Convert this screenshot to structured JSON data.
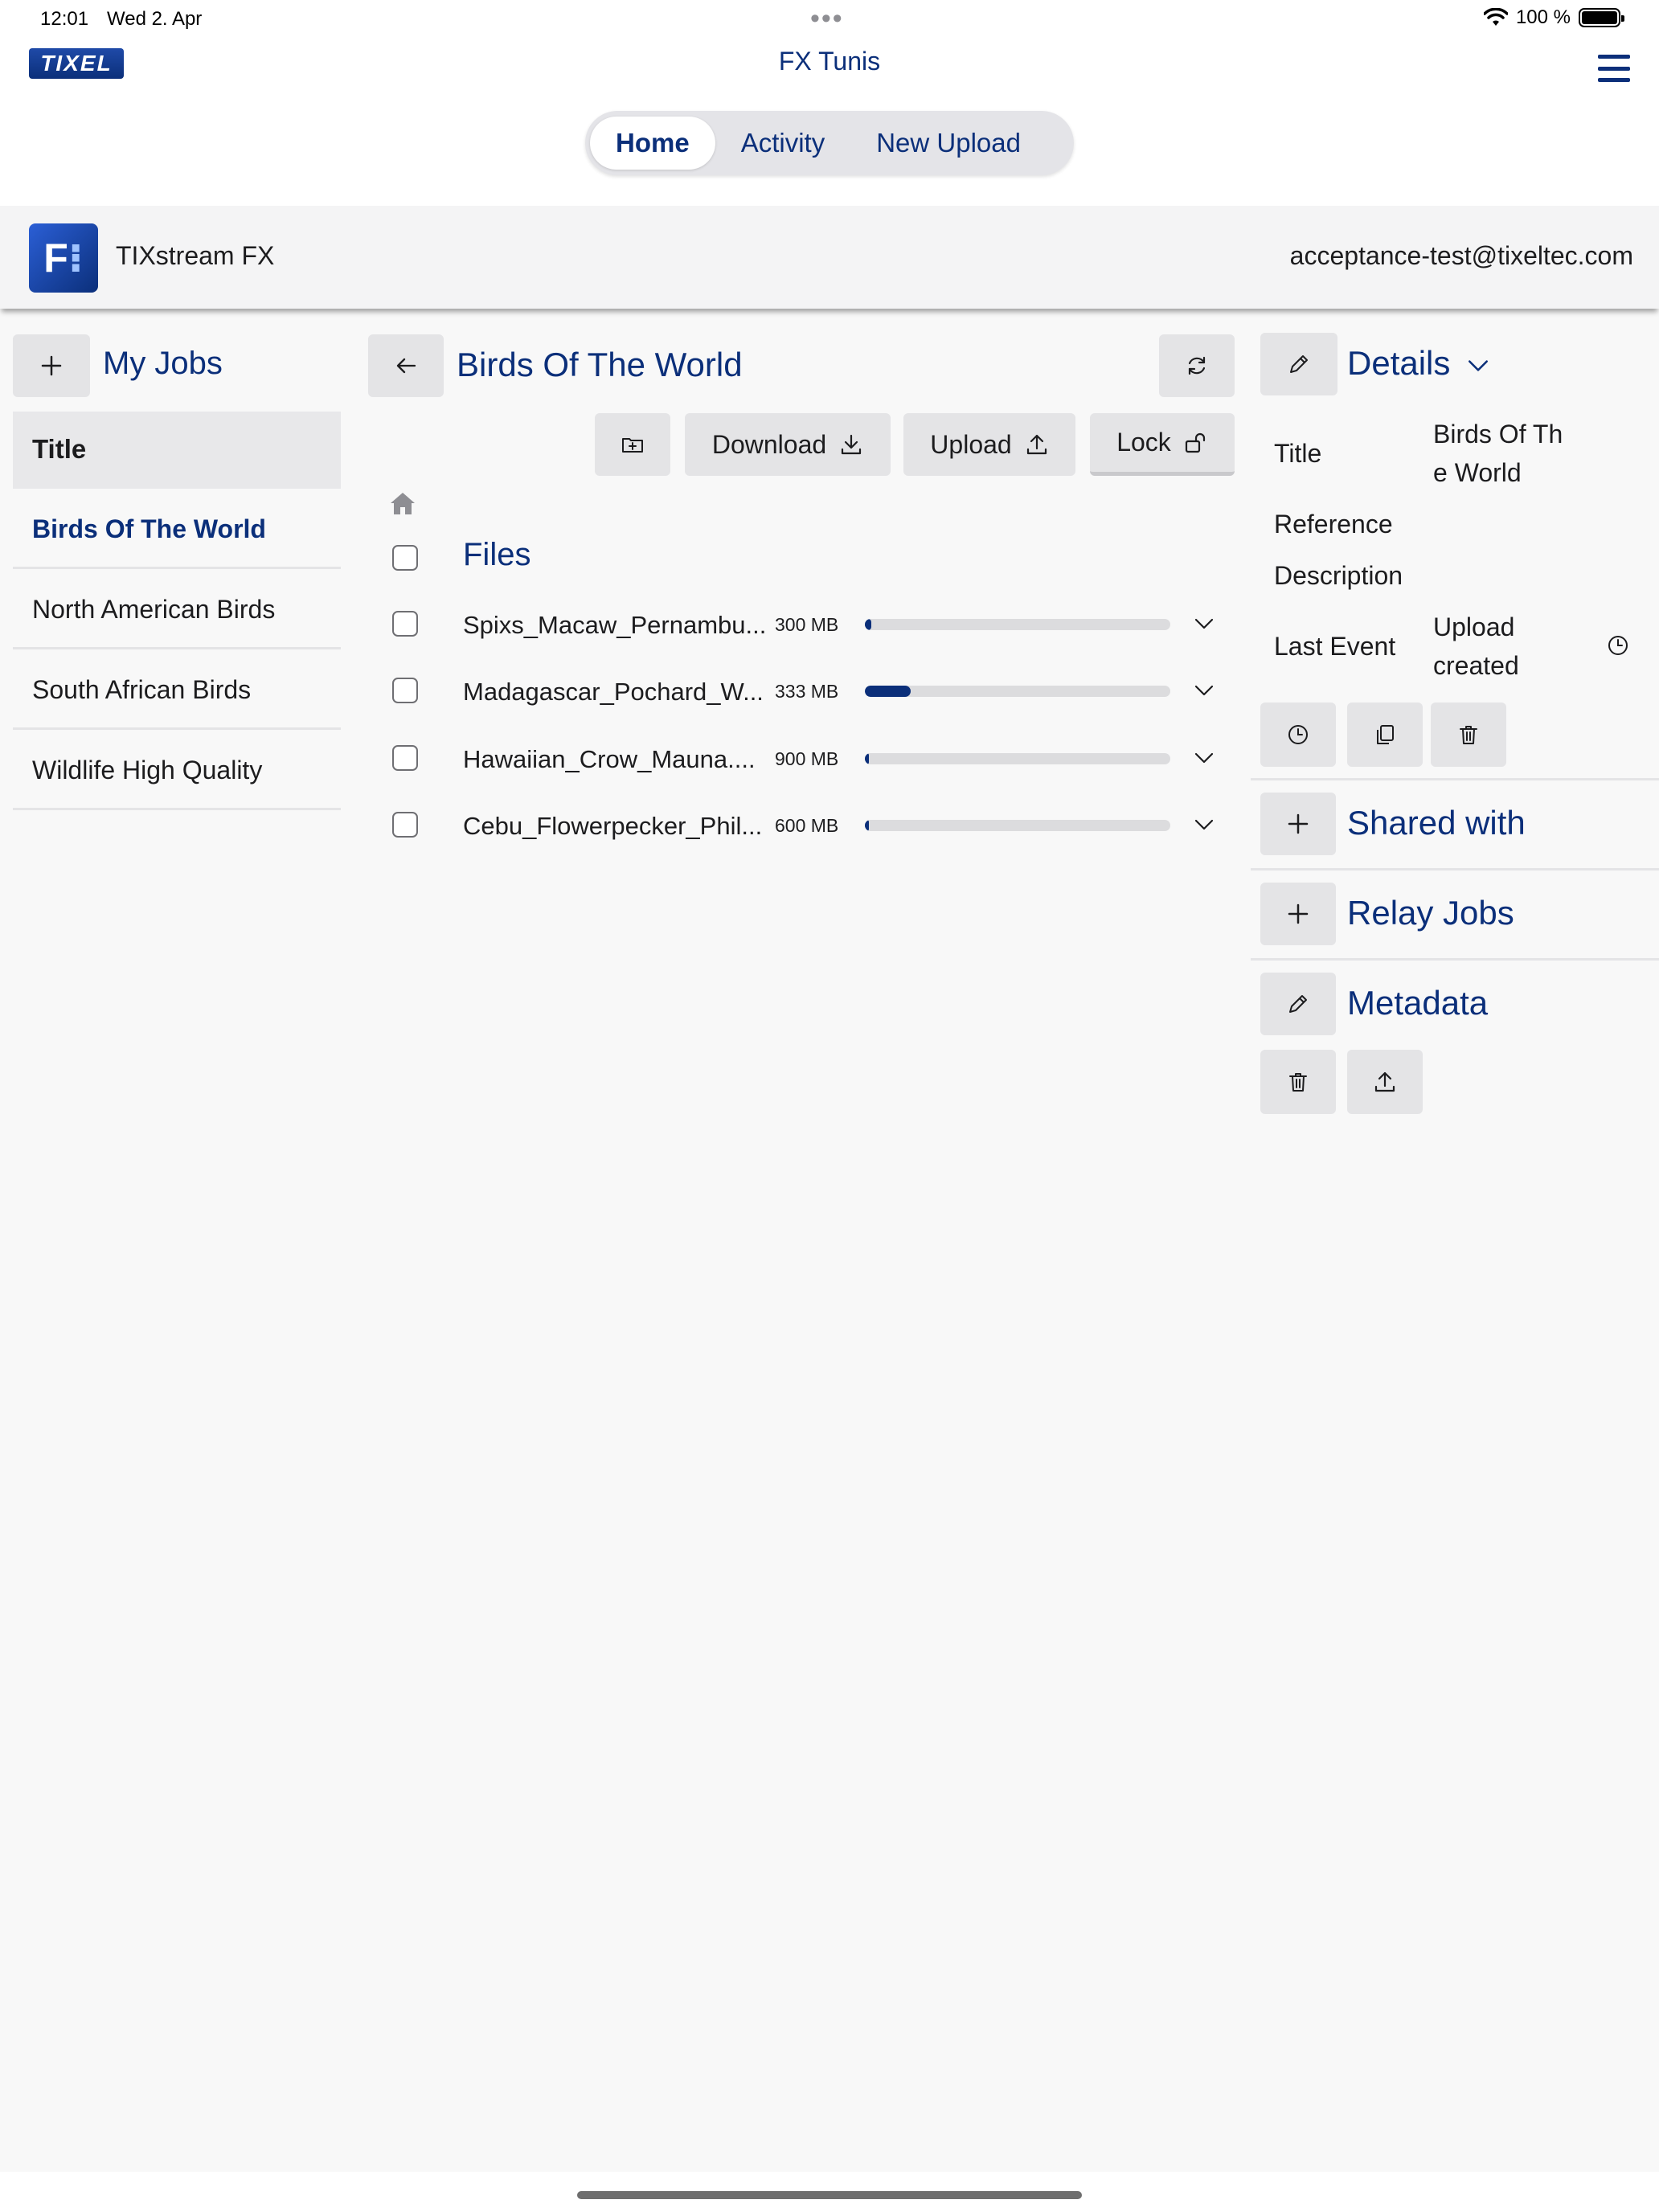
{
  "status_bar": {
    "time": "12:01",
    "date": "Wed 2. Apr",
    "battery": "100 %"
  },
  "header": {
    "logo_text": "TIXEL",
    "app_title": "FX Tunis",
    "tabs": [
      {
        "label": "Home",
        "active": true
      },
      {
        "label": "Activity",
        "active": false
      },
      {
        "label": "New Upload",
        "active": false
      }
    ]
  },
  "sub_header": {
    "product_name": "TIXstream FX",
    "user_email": "acceptance-test@tixeltec.com"
  },
  "jobs_panel": {
    "title": "My Jobs",
    "column_header": "Title",
    "items": [
      {
        "label": "Birds Of The World",
        "selected": true
      },
      {
        "label": "North American Birds",
        "selected": false
      },
      {
        "label": "South African Birds",
        "selected": false
      },
      {
        "label": "Wildlife High Quality",
        "selected": false
      }
    ]
  },
  "job_view": {
    "title": "Birds Of The World",
    "toolbar": {
      "download_label": "Download",
      "upload_label": "Upload",
      "lock_label": "Lock"
    },
    "files_label": "Files",
    "files": [
      {
        "name": "Spixs_Macaw_Pernambu...",
        "size": "300 MB",
        "progress": 0.02
      },
      {
        "name": "Madagascar_Pochard_W...",
        "size": "333 MB",
        "progress": 0.15
      },
      {
        "name": "Hawaiian_Crow_Mauna....",
        "size": "900 MB",
        "progress": 0.01
      },
      {
        "name": "Cebu_Flowerpecker_Phil...",
        "size": "600 MB",
        "progress": 0.01
      }
    ]
  },
  "details_panel": {
    "title": "Details",
    "fields": [
      {
        "label": "Title",
        "value": "Birds Of Th\ne World"
      },
      {
        "label": "Reference",
        "value": ""
      },
      {
        "label": "Description",
        "value": ""
      },
      {
        "label": "Last Event",
        "value": "Upload\ncreated"
      }
    ],
    "shared_with_title": "Shared with",
    "relay_jobs_title": "Relay Jobs",
    "metadata_title": "Metadata"
  },
  "colors": {
    "accent": "#0b2f7a",
    "button_bg": "#e4e4e6",
    "panel_bg": "#f8f8f8"
  }
}
